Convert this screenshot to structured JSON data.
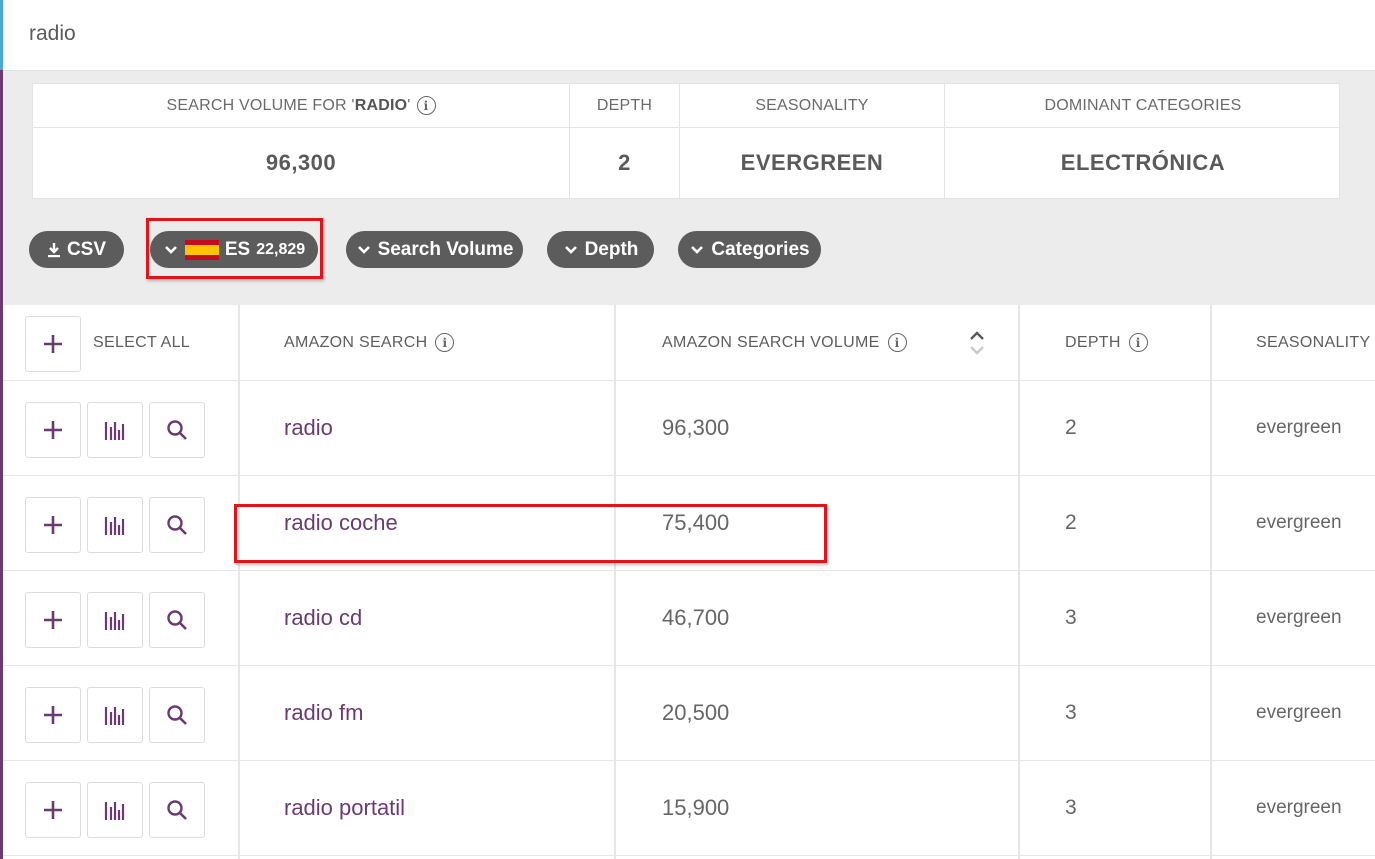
{
  "search": {
    "query": "radio"
  },
  "summary": {
    "volume_label_prefix": "SEARCH VOLUME FOR '",
    "volume_label_keyword": "RADIO",
    "volume_label_suffix": "'",
    "volume_value": "96,300",
    "depth_label": "DEPTH",
    "depth_value": "2",
    "seasonality_label": "SEASONALITY",
    "seasonality_value": "EVERGREEN",
    "categories_label": "DOMINANT CATEGORIES",
    "categories_value": "ELECTRÓNICA"
  },
  "toolbar": {
    "csv_label": "CSV",
    "country_code": "ES",
    "country_count": "22,829",
    "search_volume_label": "Search Volume",
    "depth_label": "Depth",
    "categories_label": "Categories"
  },
  "table": {
    "select_all_label": "SELECT ALL",
    "col_search": "AMAZON SEARCH",
    "col_volume": "AMAZON SEARCH VOLUME",
    "col_depth": "DEPTH",
    "col_seasonality": "SEASONALITY",
    "rows": [
      {
        "keyword": "radio",
        "volume": "96,300",
        "depth": "2",
        "seasonality": "evergreen"
      },
      {
        "keyword": "radio coche",
        "volume": "75,400",
        "depth": "2",
        "seasonality": "evergreen"
      },
      {
        "keyword": "radio cd",
        "volume": "46,700",
        "depth": "3",
        "seasonality": "evergreen"
      },
      {
        "keyword": "radio fm",
        "volume": "20,500",
        "depth": "3",
        "seasonality": "evergreen"
      },
      {
        "keyword": "radio portatil",
        "volume": "15,900",
        "depth": "3",
        "seasonality": "evergreen"
      }
    ]
  },
  "colors": {
    "keyword_purple": "#6a3a73",
    "pill_bg": "#5c5c5c",
    "highlight_red": "#e0141b",
    "accent_purple": "#6b3a6e"
  },
  "icons": [
    "download-icon",
    "chevron-down-icon",
    "spain-flag-icon",
    "info-icon",
    "plus-icon",
    "bar-chart-icon",
    "search-icon",
    "sort-icon"
  ]
}
